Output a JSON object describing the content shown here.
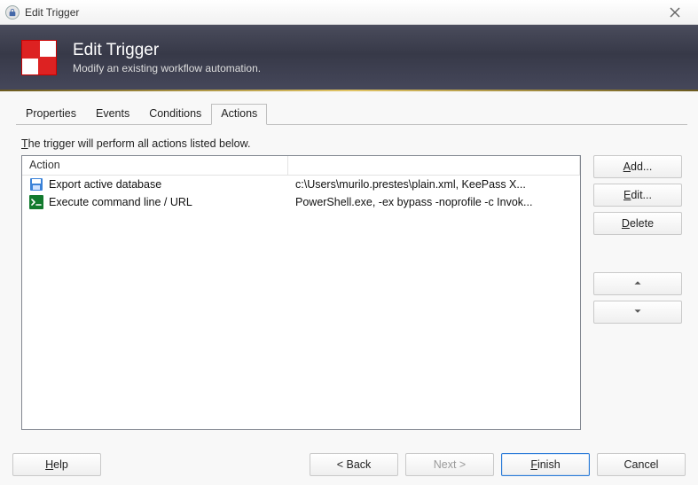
{
  "title": "Edit Trigger",
  "banner": {
    "heading": "Edit Trigger",
    "subheading": "Modify an existing workflow automation."
  },
  "tabs": {
    "properties": "Properties",
    "events": "Events",
    "conditions": "Conditions",
    "actions": "Actions"
  },
  "hint_pre": "T",
  "hint_rest": "he trigger will perform all actions listed below.",
  "columns": {
    "action": "Action",
    "detail": ""
  },
  "rows": [
    {
      "icon": "disk",
      "action": "Export active database",
      "detail": "c:\\Users\\murilo.prestes\\plain.xml, KeePass X..."
    },
    {
      "icon": "term",
      "action": "Execute command line / URL",
      "detail": "PowerShell.exe, -ex bypass -noprofile -c Invok..."
    }
  ],
  "buttons": {
    "add": {
      "u": "A",
      "rest": "dd..."
    },
    "edit": {
      "u": "E",
      "rest": "dit..."
    },
    "delete": {
      "u": "D",
      "rest": "elete"
    },
    "help": {
      "u": "H",
      "rest": "elp"
    },
    "back": "< Back",
    "next": "Next >",
    "finish": {
      "u": "F",
      "rest": "inish"
    },
    "cancel": "Cancel"
  }
}
